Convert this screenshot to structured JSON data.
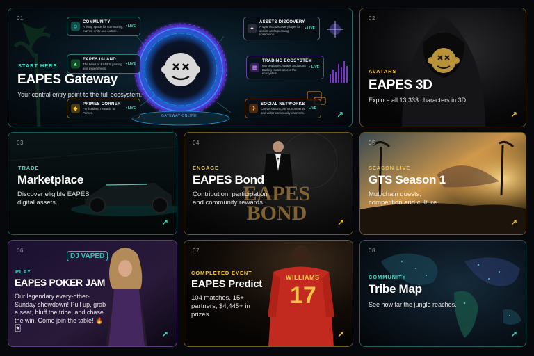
{
  "cards": [
    {
      "num": "01",
      "eyebrow": "START HERE",
      "title": "EAPES Gateway",
      "desc": "Your central entry point to the full ecosystem.",
      "portal_caption": "GATEWAY ONLINE",
      "pills": [
        {
          "title": "COMMUNITY",
          "desc": "A living space for community, events, unity and culture.",
          "live": "• LIVE"
        },
        {
          "title": "EAPES ISLAND",
          "desc": "The heart of EAPES gaming and experiences.",
          "live": "• LIVE"
        },
        {
          "title": "PRIMES CORNER",
          "desc": "For holders, rewards for Primes.",
          "live": "• LIVE"
        },
        {
          "title": "ASSETS DISCOVERY",
          "desc": "A synthetic discovery layer for assets and upcoming collections.",
          "live": "• LIVE"
        },
        {
          "title": "TRADING ECOSYSTEM",
          "desc": "Marketplaces, swaps and asset trading routes across the ecosystem.",
          "live": "• LIVE"
        },
        {
          "title": "SOCIAL NETWORKS",
          "desc": "Conversations, announcements, and wider community channels.",
          "live": "• LIVE"
        }
      ]
    },
    {
      "num": "02",
      "eyebrow": "AVATARS",
      "title": "EAPES 3D",
      "desc": "Explore all 13,333 characters in 3D."
    },
    {
      "num": "03",
      "eyebrow": "TRADE",
      "title": "Marketplace",
      "desc": "Discover eligible EAPES digital assets."
    },
    {
      "num": "04",
      "eyebrow": "ENGAGE",
      "title": "EAPES Bond",
      "desc": "Contribution, participation and community rewards.",
      "art_text": "EAPES BOND"
    },
    {
      "num": "05",
      "eyebrow": "SEASON LIVE",
      "title": "GTS Season 1",
      "desc": "Multichain quests, competition and culture."
    },
    {
      "num": "06",
      "eyebrow": "PLAY",
      "title": "EAPES POKER JAM",
      "desc": "Our legendary every-other-Sunday showdown! Pull up, grab a seat, bluff the tribe, and chase the win. Come join the table! 🔥 🃏",
      "sign_text": "DJ VAPED"
    },
    {
      "num": "07",
      "eyebrow": "COMPLETED EVENT",
      "title": "EAPES Predict",
      "desc": "104 matches, 15+ partners, $4,445+ in prizes.",
      "jersey_name": "WILLIAMS",
      "jersey_number": "17"
    },
    {
      "num": "08",
      "eyebrow": "COMMUNITY",
      "title": "Tribe Map",
      "desc": "See how far the jungle reaches."
    }
  ],
  "arrow_glyph": "↗",
  "colors": {
    "teal": "#3fd9c5",
    "gold": "#f0c53a",
    "purple": "#a37cf0"
  }
}
